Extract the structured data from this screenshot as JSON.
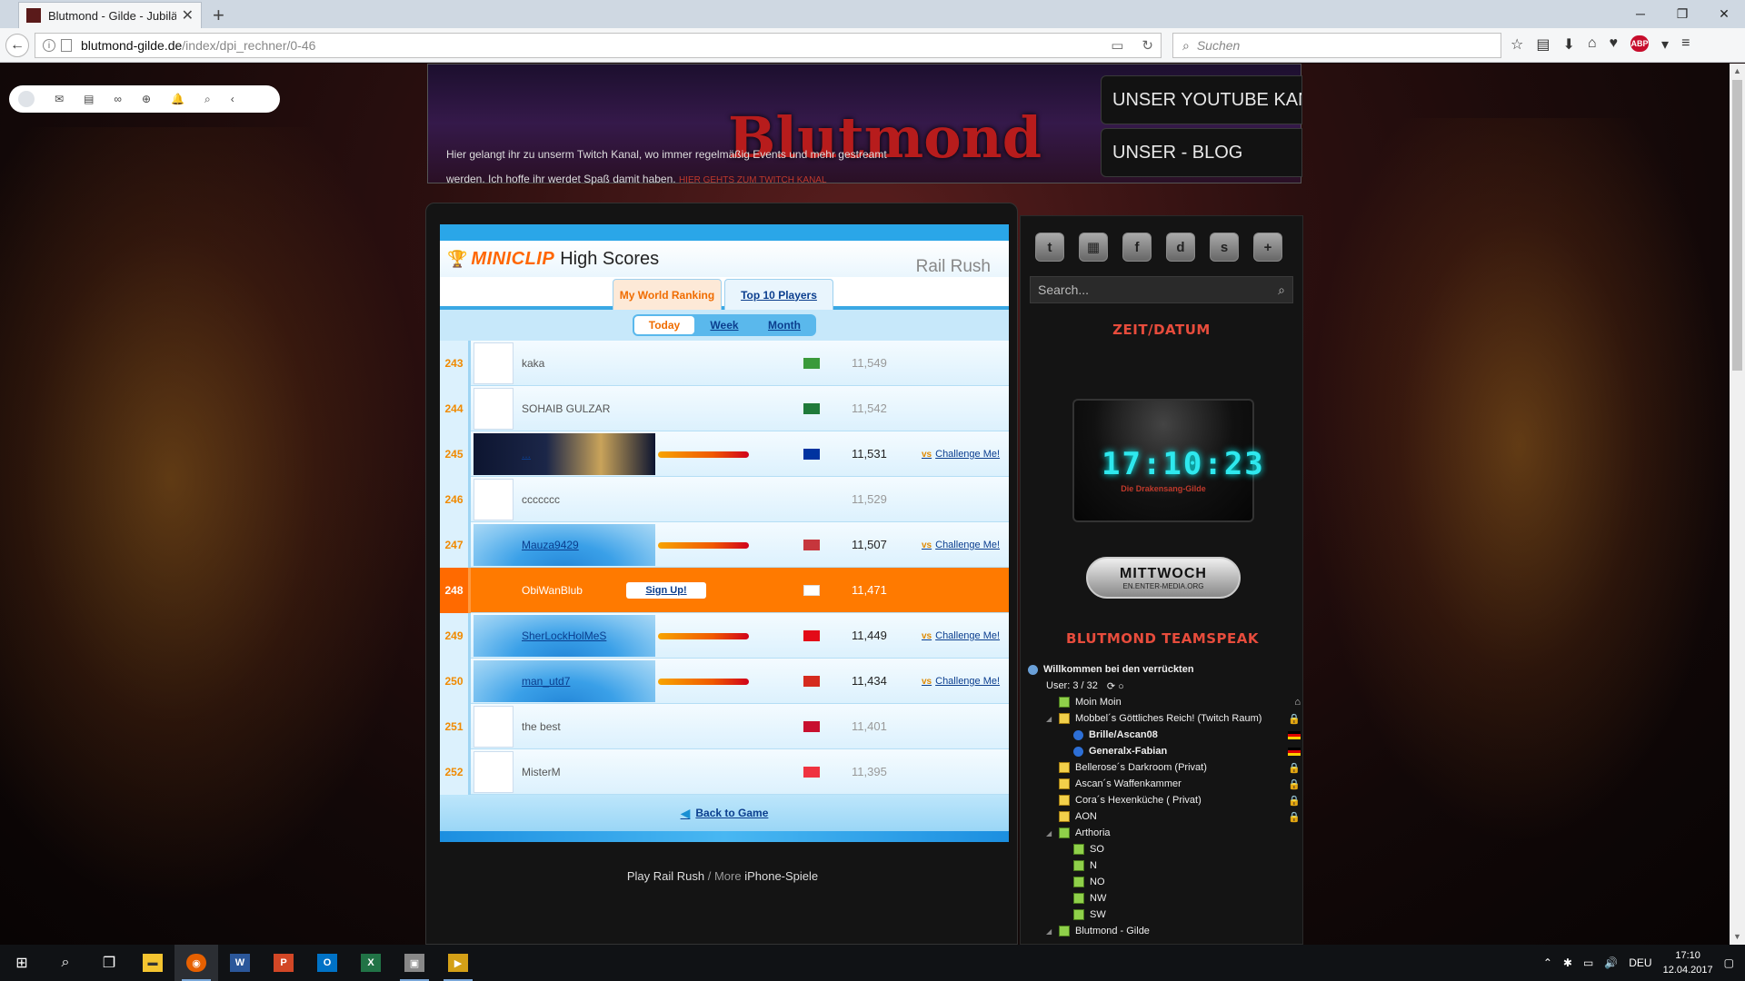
{
  "browser": {
    "tab_title": "Blutmond - Gilde - Jubiläu...",
    "tab_close": "✕",
    "new_tab": "+",
    "url_host": "blutmond-gilde.de",
    "url_path": "/index/dpi_rechner/0-46",
    "search_placeholder": "Suchen"
  },
  "banner": {
    "logo": "Blutmond",
    "twitch_text": "Hier gelangt ihr zu unserm Twitch Kanal, wo immer regelmäßig Events und mehr gestreamt werden. Ich hoffe ihr werdet Spaß damit haben.",
    "twitch_link": "HIER GEHTS ZUM TWITCH KANAL",
    "btn_youtube": "UNSER YOUTUBE KANAL",
    "btn_blog": "UNSER - BLOG"
  },
  "game": {
    "brand": "MINICLIP",
    "title": "High Scores",
    "game_name": "Rail Rush",
    "tab_my_ranking": "My World Ranking",
    "tab_top10": "Top 10 Players",
    "period_today": "Today",
    "period_week": "Week",
    "period_month": "Month",
    "back_to_game": "Back to Game",
    "signup": "Sign Up!",
    "challenge": "Challenge Me!",
    "vs": "vs",
    "rows": [
      {
        "rank": "243",
        "name": "kaka",
        "score": "11,549",
        "flag_color": "#3a9a3a",
        "avatar": false
      },
      {
        "rank": "244",
        "name": "SOHAIB GULZAR",
        "score": "11,542",
        "flag_color": "#1f7a3a",
        "avatar": false
      },
      {
        "rank": "245",
        "name": "...",
        "score": "11,531",
        "flag_color": "#0033a0",
        "avatar": true
      },
      {
        "rank": "246",
        "name": "ccccccc",
        "score": "11,529",
        "flag_color": "",
        "avatar": false
      },
      {
        "rank": "247",
        "name": "Mauza9429",
        "score": "11,507",
        "flag_color": "#c6363c",
        "avatar": true
      },
      {
        "rank": "248",
        "name": "ObiWanBlub",
        "score": "11,471",
        "flag_color": "#ffffff",
        "avatar": false
      },
      {
        "rank": "249",
        "name": "SherLockHolMeS",
        "score": "11,449",
        "flag_color": "#e30a17",
        "avatar": true
      },
      {
        "rank": "250",
        "name": "man_utd7",
        "score": "11,434",
        "flag_color": "#d52b1e",
        "avatar": true
      },
      {
        "rank": "251",
        "name": "the best",
        "score": "11,401",
        "flag_color": "#c8102e",
        "avatar": false
      },
      {
        "rank": "252",
        "name": "MisterM",
        "score": "11,395",
        "flag_color": "#ef3340",
        "avatar": false
      }
    ]
  },
  "play_line": {
    "play": "Play Rail Rush",
    "sep": "/ More",
    "more": "iPhone-Spiele"
  },
  "sidebar": {
    "search_placeholder": "Search...",
    "zeit_head": "Zeit/Datum",
    "clock_time": "17:10:23",
    "clock_sub": "Die Drakensang-Gilde",
    "mittwoch": "MITTWOCH",
    "mittwoch_sub": "EN.ENTER-MEDIA.ORG",
    "ts_head": "Blutmond Teamspeak",
    "ts_welcome": "Willkommen bei den verrückten",
    "ts_users": "User: 3 / 32",
    "channels": [
      {
        "name": "Moin Moin",
        "level": 0,
        "type": "g",
        "lock": "⌂"
      },
      {
        "name": "Mobbel´s Göttliches Reich! (Twitch Raum)",
        "level": 0,
        "type": "y",
        "lock": "🔒",
        "expanded": true
      },
      {
        "name": "Brille/Ascan08",
        "level": 1,
        "type": "u",
        "bold": true
      },
      {
        "name": "Generalx-Fabian",
        "level": 1,
        "type": "u",
        "bold": true
      },
      {
        "name": "Bellerose´s Darkroom (Privat)",
        "level": 0,
        "type": "y",
        "lock": "🔒"
      },
      {
        "name": "Ascan´s Waffenkammer",
        "level": 0,
        "type": "y",
        "lock": "🔒"
      },
      {
        "name": "Cora´s Hexenküche ( Privat)",
        "level": 0,
        "type": "y",
        "lock": "🔒"
      },
      {
        "name": "AON",
        "level": 0,
        "type": "y",
        "lock": "🔒"
      },
      {
        "name": "Arthoria",
        "level": 0,
        "type": "g",
        "expanded": true
      },
      {
        "name": "SO",
        "level": 1,
        "type": "g"
      },
      {
        "name": "N",
        "level": 1,
        "type": "g"
      },
      {
        "name": "NO",
        "level": 1,
        "type": "g"
      },
      {
        "name": "NW",
        "level": 1,
        "type": "g"
      },
      {
        "name": "SW",
        "level": 1,
        "type": "g"
      },
      {
        "name": "Blutmond - Gilde",
        "level": 0,
        "type": "g",
        "expanded": true
      }
    ]
  },
  "taskbar": {
    "lang": "DEU",
    "time": "17:10",
    "date": "12.04.2017"
  }
}
